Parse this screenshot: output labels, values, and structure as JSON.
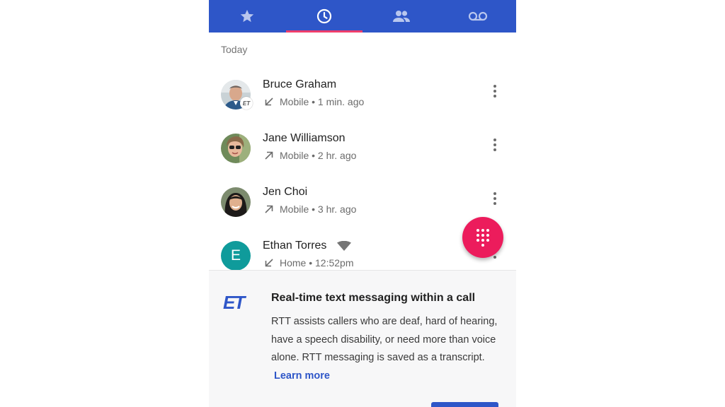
{
  "tabs": [
    {
      "name": "Favorites",
      "icon": "star-icon"
    },
    {
      "name": "Recents",
      "icon": "clock-icon",
      "selected": true
    },
    {
      "name": "Contacts",
      "icon": "people-icon"
    },
    {
      "name": "Voicemail",
      "icon": "voicemail-icon"
    }
  ],
  "section_label": "Today",
  "calls": [
    {
      "name": "Bruce Graham",
      "direction_icon": "incoming-call-icon",
      "detail": "Mobile • 1 min. ago",
      "rtt_badge": "ЕT"
    },
    {
      "name": "Jane Williamson",
      "direction_icon": "outgoing-call-icon",
      "detail": "Mobile • 2 hr. ago"
    },
    {
      "name": "Jen Choi",
      "direction_icon": "outgoing-call-icon",
      "detail": "Mobile • 3 hr. ago"
    },
    {
      "name": "Ethan Torres",
      "avatar_letter": "E",
      "direction_icon": "incoming-call-icon",
      "detail": "Home • 12:52pm",
      "extra_icon": "wifi-call-icon"
    }
  ],
  "fab_icon": "dialpad-icon",
  "promo": {
    "logo": "ET",
    "title": "Real-time text messaging within a call",
    "body": "RTT assists callers who are deaf, hard of hearing, have a speech disability, or need more than voice alone. RTT messaging is saved as a transcript.",
    "link": "Learn more"
  },
  "colors": {
    "header": "#2e56c8",
    "tab_indicator": "#ef3d6c",
    "fab": "#ec1c5c",
    "letter_avatar": "#0f9b9b",
    "link": "#2e56c8"
  }
}
